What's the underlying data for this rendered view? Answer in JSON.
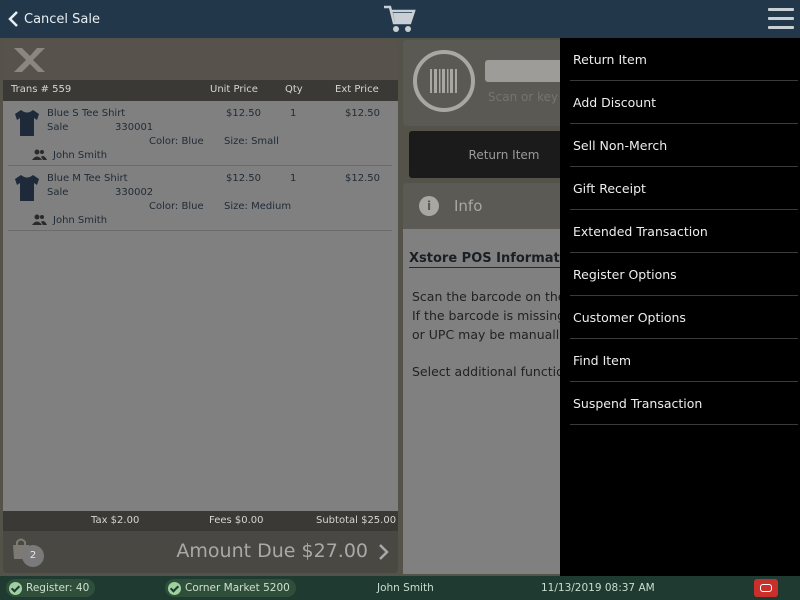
{
  "topbar": {
    "cancel_label": "Cancel Sale"
  },
  "transaction": {
    "number": "Trans # 559",
    "columns": {
      "unit_price": "Unit Price",
      "qty": "Qty",
      "ext_price": "Ext Price"
    },
    "items": [
      {
        "name": "Blue S Tee Shirt",
        "type": "Sale",
        "sku": "330001",
        "unit_price": "$12.50",
        "qty": "1",
        "ext_price": "$12.50",
        "color": "Color: Blue",
        "size": "Size: Small",
        "associate": "John Smith"
      },
      {
        "name": "Blue M Tee Shirt",
        "type": "Sale",
        "sku": "330002",
        "unit_price": "$12.50",
        "qty": "1",
        "ext_price": "$12.50",
        "color": "Color: Blue",
        "size": "Size: Medium",
        "associate": "John Smith"
      }
    ],
    "totals": {
      "tax": "Tax $2.00",
      "fees": "Fees $0.00",
      "subtotal": "Subtotal $25.00"
    },
    "item_count": "2",
    "amount_due": "Amount Due  $27.00"
  },
  "scan": {
    "placeholder": "",
    "hint": "Scan or key a"
  },
  "return_button": "Return Item",
  "info": {
    "label": "Info",
    "title": "Xstore POS Informatio",
    "lines": [
      "Scan the barcode on the",
      "If the barcode is missing",
      "or UPC may be manuall",
      "Select additional functio"
    ]
  },
  "menu": {
    "items": [
      "Return Item",
      "Add Discount",
      "Sell Non-Merch",
      "Gift Receipt",
      "Extended Transaction",
      "Register Options",
      "Customer Options",
      "Find Item",
      "Suspend Transaction"
    ]
  },
  "status": {
    "register": "Register: 40",
    "store": "Corner Market 5200",
    "user": "John Smith",
    "datetime": "11/13/2019 08:37 AM"
  },
  "colors": {
    "topbar": "#22384a",
    "menu": "#000000",
    "status": "#1f3a30",
    "logout": "#c9302c"
  }
}
